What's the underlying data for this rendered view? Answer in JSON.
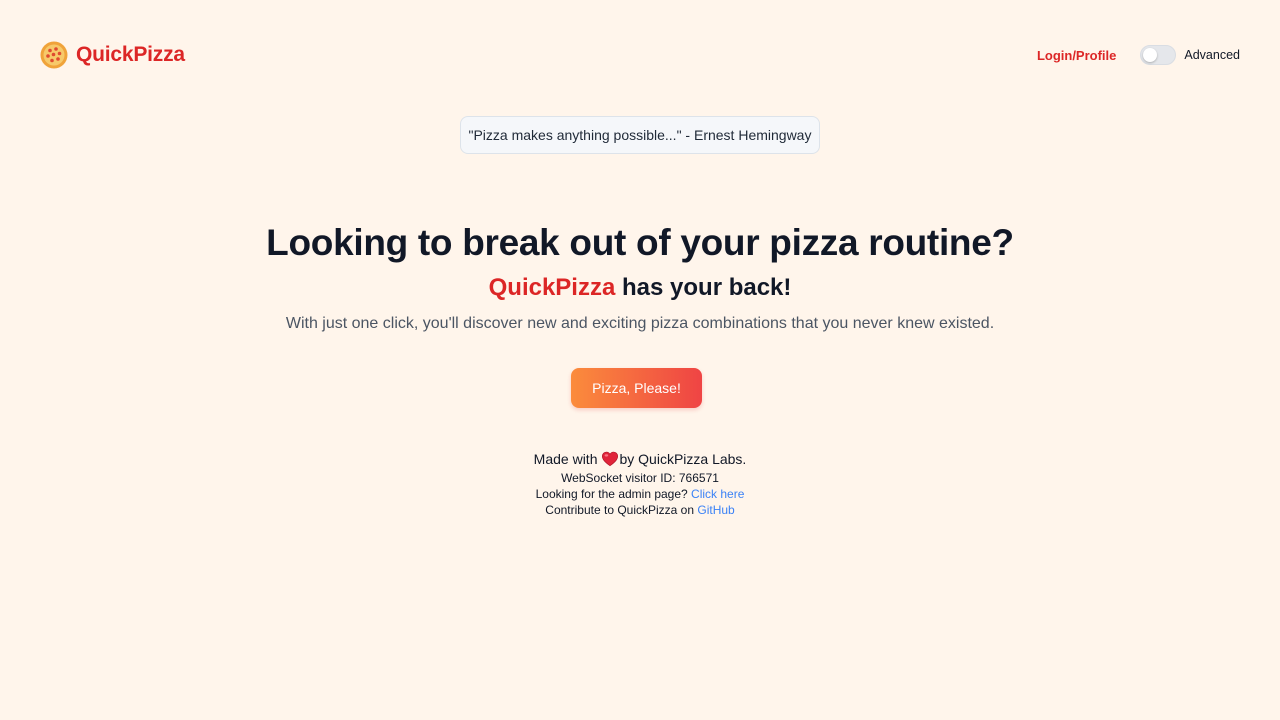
{
  "header": {
    "brand": "QuickPizza",
    "login_label": "Login/Profile",
    "toggle_label": "Advanced",
    "toggle_on": false
  },
  "quote": {
    "text": "\"Pizza makes anything possible...\" - Ernest Hemingway"
  },
  "hero": {
    "title": "Looking to break out of your pizza routine?",
    "subtitle_accent": "QuickPizza",
    "subtitle_rest": " has your back!",
    "description": "With just one click, you'll discover new and exciting pizza combinations that you never knew existed.",
    "cta_label": "Pizza, Please!"
  },
  "footer": {
    "made_with": "Made with",
    "by_label": "by QuickPizza Labs.",
    "visitor_id_text": "WebSocket visitor ID: 766571",
    "admin_text": "Looking for the admin page? ",
    "admin_link": "Click here",
    "contribute_text": "Contribute to QuickPizza on ",
    "github_link": "GitHub"
  },
  "colors": {
    "background": "#fff5eb",
    "brand_red": "#dc2626",
    "link_blue": "#3b82f6",
    "cta_gradient_start": "#fb8c3c",
    "cta_gradient_end": "#ef4444"
  },
  "icons": {
    "logo": "pizza-logo-icon",
    "heart": "heart-icon"
  }
}
